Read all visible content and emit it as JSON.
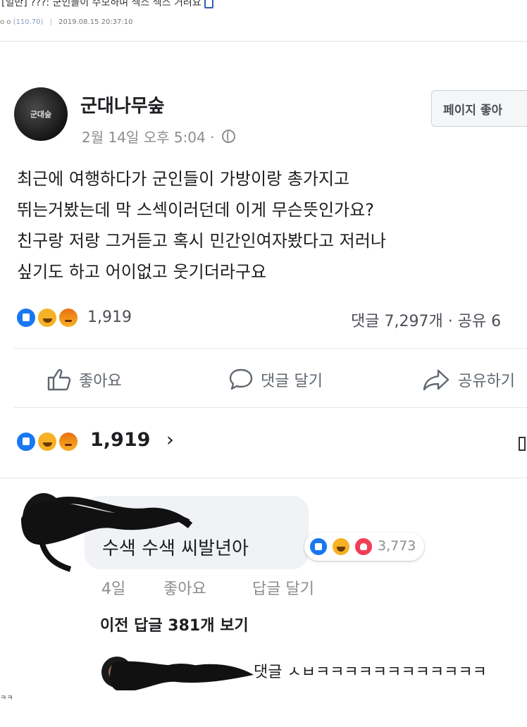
{
  "forum": {
    "title": "[일반] ???: 군인들이 수모하며 섹스 섹스 거려요",
    "author": "o o",
    "ip": "(110.70)",
    "datetime": "2019.08.15 20:37:10"
  },
  "post": {
    "page_name": "군대나무숲",
    "avatar_text": "군대숲",
    "time": "2월 14일 오후 5:04 ·",
    "like_page_label": "페이지 좋아",
    "body_lines": [
      "최근에 여행하다가 군인들이 가방이랑 총가지고",
      "뛰는거봤는데 막 스섹이러던데 이게 무슨뜻인가요?",
      "친구랑 저랑 그거듣고 혹시 민간인여자봤다고 저러나",
      "싶기도 하고 어이없고 웃기더라구요"
    ],
    "reaction_count": "1,919",
    "comments_share": "댓글 7,297개 · 공유 6",
    "actions": {
      "like": "좋아요",
      "comment": "댓글 달기",
      "share": "공유하기"
    }
  },
  "reactions_summary": {
    "count": "1,919",
    "chevron": "›"
  },
  "comment": {
    "text": "수색 수색 씨발년아",
    "reaction_count": "3,773",
    "age": "4일",
    "like": "좋아요",
    "reply": "답글 달기",
    "view_replies": "이전 답글 381개 보기",
    "reply_preview": "댓글 ㅅㅂㅋㅋㅋㅋㅋㅋㅋㅋㅋㅋㅋㅋ"
  },
  "stray": "ㅋㅋ",
  "colors": {
    "like_blue": "#1877f2",
    "haha_yellow": "#f7b125",
    "love_red": "#f33e58",
    "meta_gray": "#8a8d91"
  }
}
